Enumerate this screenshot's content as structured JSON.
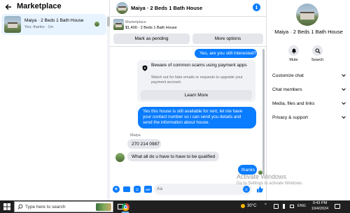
{
  "left_panel": {
    "title": "Marketplace",
    "conversation": {
      "title": "Maiya · 2 Beds 1 Bath House",
      "preview": "You: thanks · 1m"
    }
  },
  "chat_header": {
    "title": "Maiya · 2 Beds 1 Bath House",
    "listing_source": "Marketplace",
    "listing_detail": "$1,400 - 2 Beds 1 Bath House",
    "mark_pending_label": "Mark as pending",
    "more_options_label": "More options"
  },
  "messages": {
    "out_1": "Yes, are you still interested?",
    "notice_title": "Beware of common scams using payment apps",
    "notice_body": "Watch out for fake emails or requests to upgrade your payment account.",
    "notice_button": "Learn More",
    "out_2": "Yes this house is still available for rent, let me have your contact number so i can send you details and send the information about house.",
    "sender_name": "Maiya",
    "in_1": "270 214 0987",
    "in_2": "What all do u have to have to be qualified",
    "out_3": "thanks"
  },
  "composer": {
    "placeholder": "Aa"
  },
  "right_panel": {
    "title": "Maiya · 2 Beds 1 Bath House",
    "mute_label": "Mute",
    "search_label": "Search",
    "menu": [
      "Customize chat",
      "Chat members",
      "Media, files and links",
      "Privacy & support"
    ]
  },
  "watermark": {
    "title": "Activate Windows",
    "subtitle": "Go to Settings to activate Windows."
  },
  "taskbar": {
    "search_placeholder": "Type here to search",
    "temperature": "30°C",
    "language": "ENG",
    "time": "9:43 PM",
    "date": "10/4/2024"
  },
  "colors": {
    "accent": "#0a7cff",
    "bubble_in": "#e4e6eb",
    "taskbar": "#202020"
  }
}
